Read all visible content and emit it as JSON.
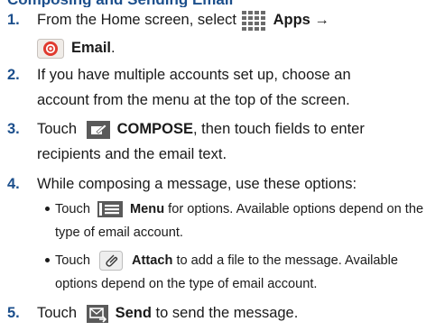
{
  "heading": "Composing and Sending Email",
  "steps": [
    {
      "num": "1.",
      "a": "From the Home screen, select ",
      "b": "Apps →",
      "c": "Email",
      "d": "."
    },
    {
      "num": "2.",
      "line1": "If you have multiple accounts set up, choose an",
      "line2": "account from the menu at the top of the screen."
    },
    {
      "num": "3.",
      "a": "Touch ",
      "b": "COMPOSE",
      "c": ", then touch fields to enter",
      "line2": "recipients and the email text."
    },
    {
      "num": "4.",
      "line1": "While composing a message, use these options:"
    },
    {
      "num": "5.",
      "a": "Touch ",
      "b": "Send",
      "c": " to send the message."
    }
  ],
  "bullets": [
    {
      "a": "Touch ",
      "b": "Menu",
      "c": " for options. Available options depend on the",
      "line2": "type of email account."
    },
    {
      "a": "Touch ",
      "b": "Attach",
      "c": " to add a file to the message. Available",
      "line2": "options depend on the type of email account."
    }
  ],
  "icons": [
    "apps-icon",
    "email-icon",
    "compose-icon",
    "menu-icon",
    "attach-icon",
    "send-icon"
  ]
}
